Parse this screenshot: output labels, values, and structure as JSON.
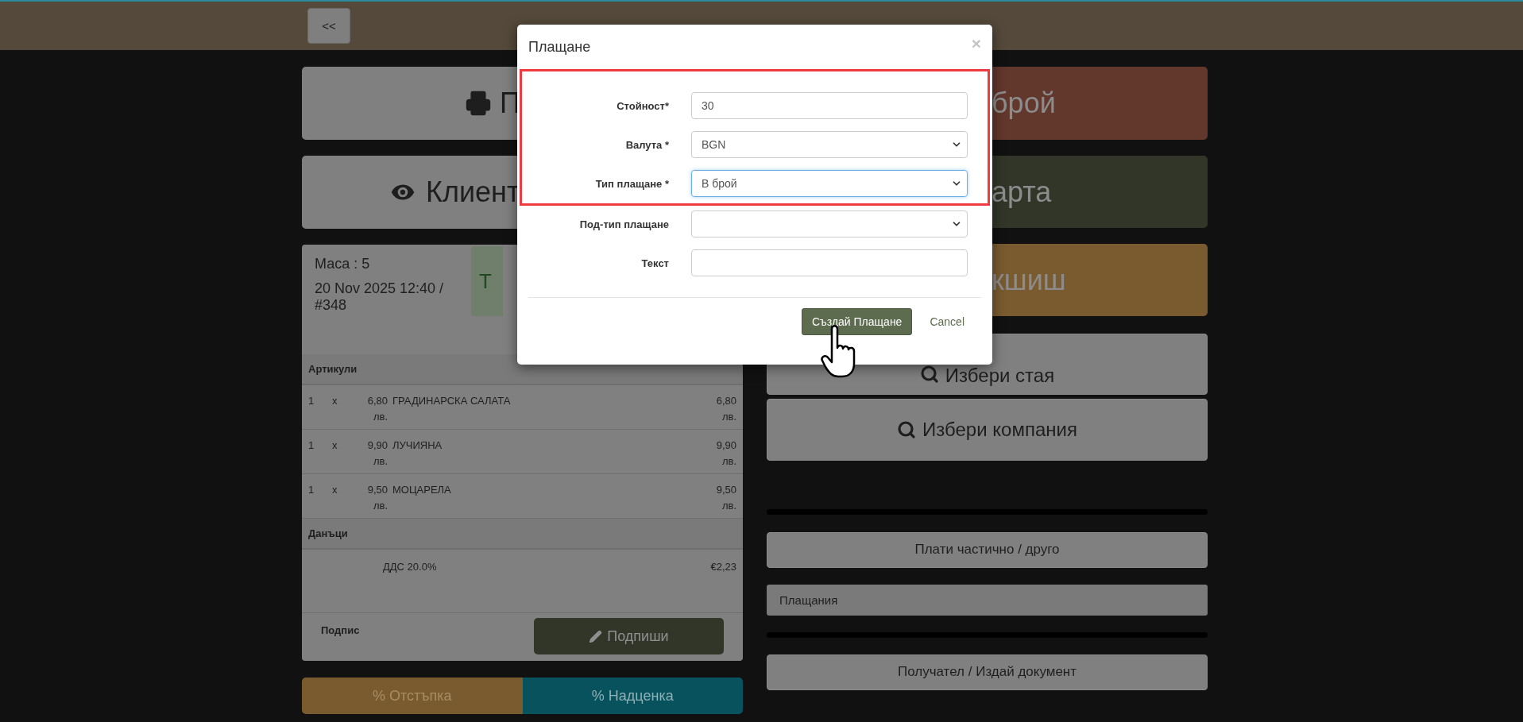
{
  "top_bar": {
    "back_button": "<<"
  },
  "left": {
    "action_buttons": [
      {
        "kind": "print",
        "label": "П"
      },
      {
        "kind": "view",
        "label": "Клиент"
      }
    ],
    "order": {
      "table": "Маса : 5",
      "datetime": "20 Nov 2025 12:40 / #348",
      "status": "Т",
      "items_header": "Артикули",
      "items": [
        {
          "qty": "1",
          "times": "x",
          "price": "6,80 лв.",
          "name": "ГРАДИНАРСКА САЛАТА",
          "total": "6,80 лв."
        },
        {
          "qty": "1",
          "times": "x",
          "price": "9,90 лв.",
          "name": "ЛУЧИЯНА",
          "total": "9,90 лв."
        },
        {
          "qty": "1",
          "times": "x",
          "price": "9,50 лв.",
          "name": "МОЦАРЕЛА",
          "total": "9,50 лв."
        }
      ],
      "taxes_header": "Данъци",
      "taxes": [
        {
          "name": "ДДС 20.0%",
          "amount": "€2,23"
        }
      ],
      "signature_label": "Подпис",
      "sign_button": "Подпиши"
    },
    "adjust_buttons": [
      {
        "kind": "discount",
        "label": "% Отстъпка"
      },
      {
        "kind": "markup",
        "label": "% Надценка"
      }
    ]
  },
  "right": {
    "payment_buttons": [
      {
        "label": "брой",
        "color": "#62372c"
      },
      {
        "label": "арта",
        "color": "#313629"
      },
      {
        "label": "кшиш",
        "color": "#7a5b30"
      }
    ],
    "search_buttons": [
      "Избери стая",
      "Избери компания"
    ],
    "partial_button": "Плати частично / друго",
    "payments_panel": "Плащания",
    "document_button": "Получател / Издай документ"
  },
  "modal": {
    "title": "Плащане",
    "close": "×",
    "highlighted_fields": [
      {
        "label": "Стойност*",
        "kind": "input",
        "value": "30",
        "focused": false
      },
      {
        "label": "Валута *",
        "kind": "select",
        "value": "BGN",
        "focused": false
      },
      {
        "label": "Тип плащане *",
        "kind": "select",
        "value": "В брой",
        "focused": true
      }
    ],
    "fields": [
      {
        "label": "Под-тип плащане",
        "kind": "select",
        "focused": false
      },
      {
        "label": "Текст",
        "kind": "input",
        "focused": false
      }
    ],
    "submit": "Създай Плащане",
    "cancel": "Cancel"
  }
}
